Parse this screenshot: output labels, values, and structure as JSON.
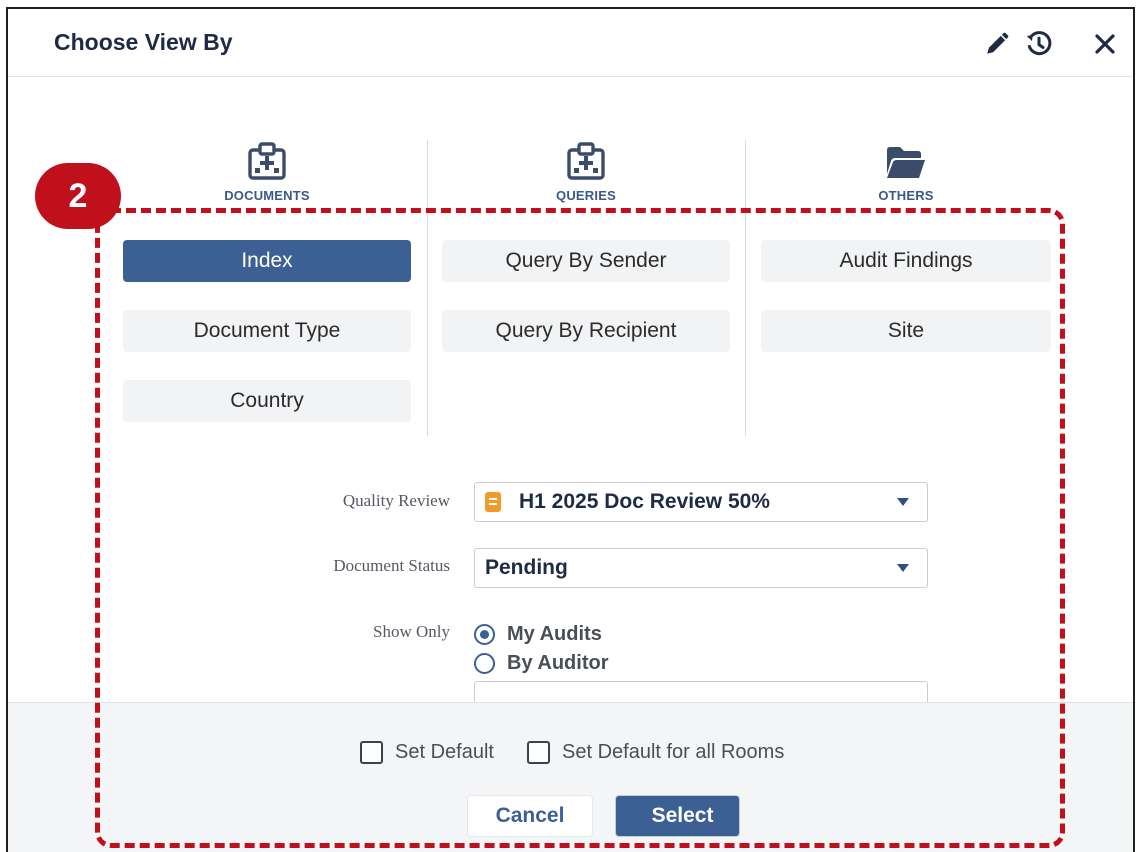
{
  "dialog": {
    "title": "Choose View By",
    "header_icons": [
      "pencil-icon",
      "history-icon",
      "close-icon"
    ]
  },
  "categories": [
    {
      "label": "DOCUMENTS",
      "icon": "hospital-icon",
      "options": [
        "Index",
        "Document Type",
        "Country"
      ],
      "active_index": 0
    },
    {
      "label": "QUERIES",
      "icon": "hospital-icon",
      "options": [
        "Query By Sender",
        "Query By Recipient"
      ]
    },
    {
      "label": "OTHERS",
      "icon": "folder-open-icon",
      "options": [
        "Audit Findings",
        "Site"
      ]
    }
  ],
  "form": {
    "quality_review": {
      "label": "Quality Review",
      "value": "H1 2025 Doc Review 50%",
      "icon": "book-icon"
    },
    "document_status": {
      "label": "Document Status",
      "value": "Pending"
    },
    "show_only": {
      "label": "Show Only",
      "options": [
        {
          "label": "My Audits",
          "selected": true
        },
        {
          "label": "By Auditor",
          "selected": false
        }
      ]
    }
  },
  "footer": {
    "set_default": "Set Default",
    "set_default_all": "Set Default for all Rooms",
    "cancel": "Cancel",
    "select": "Select"
  },
  "annotation": {
    "step": "2",
    "color": "#c0101c"
  },
  "colors": {
    "accent": "#3c5f94",
    "title": "#1f2a44"
  }
}
